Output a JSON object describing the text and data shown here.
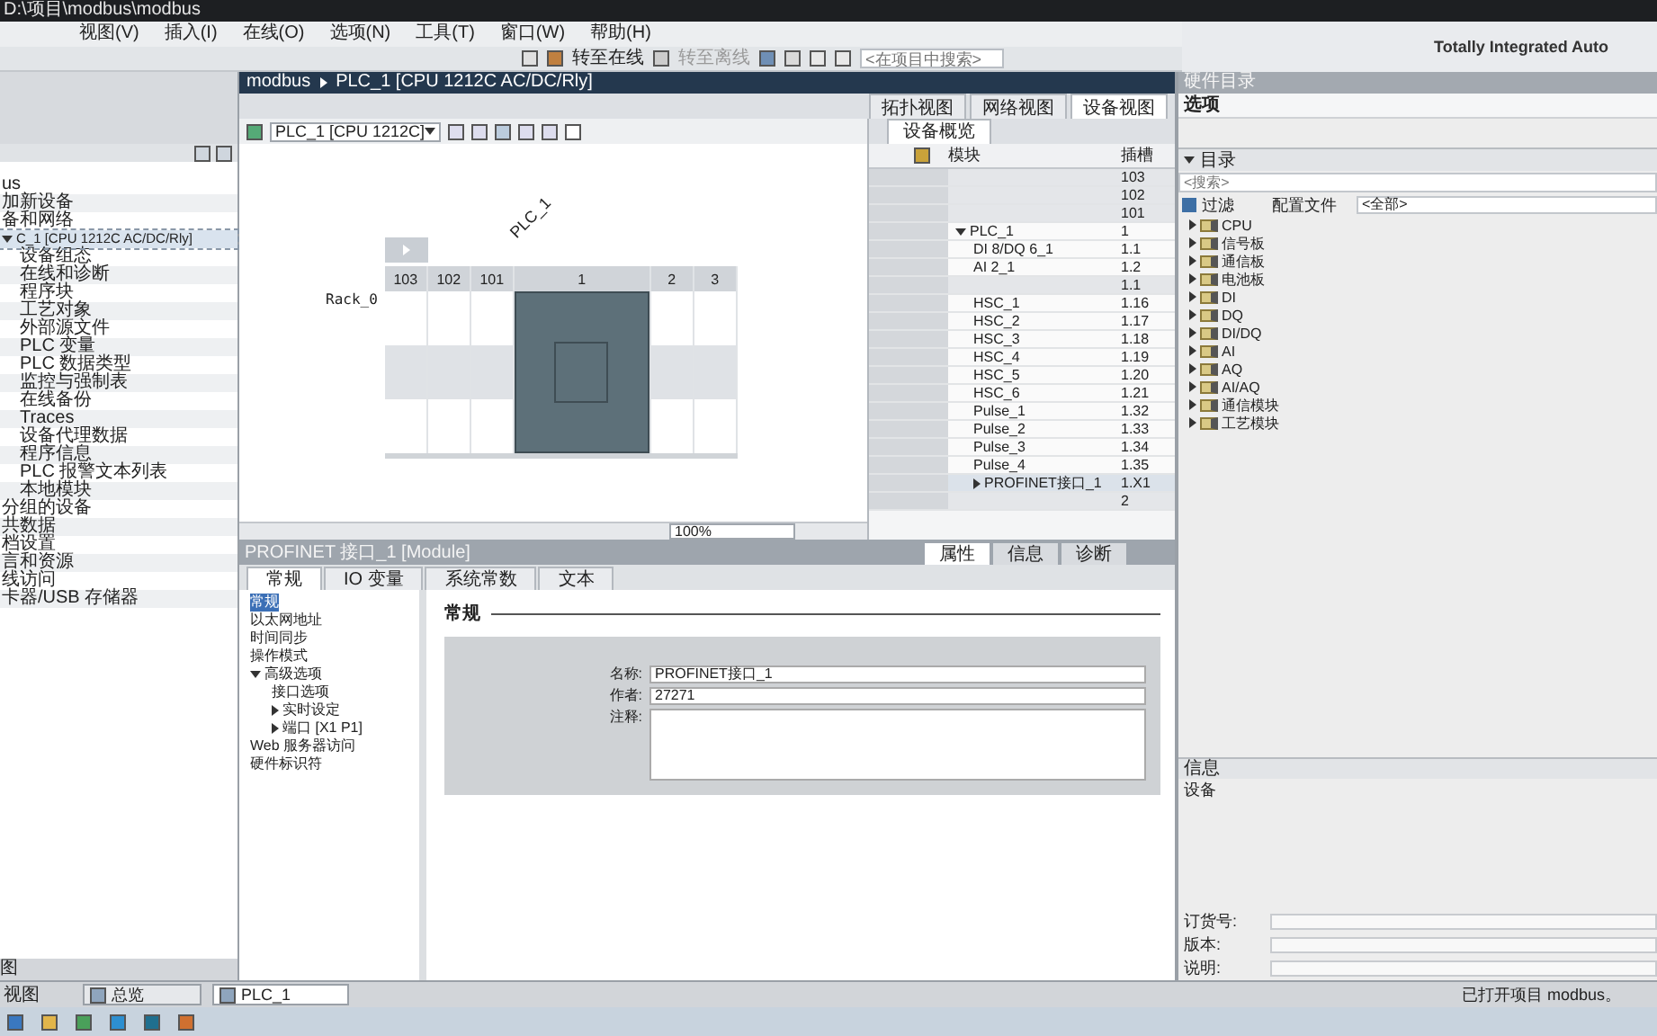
{
  "title_bar": {
    "title": "D:\\项目\\modbus\\modbus"
  },
  "brand": "Totally Integrated Auto",
  "menus": [
    "视图(V)",
    "插入(I)",
    "在线(O)",
    "选项(N)",
    "工具(T)",
    "窗口(W)",
    "帮助(H)"
  ],
  "toolbar": {
    "go_online": "转至在线",
    "go_offline": "转至离线",
    "search_placeholder": "<在项目中搜索>"
  },
  "project_tree": {
    "items": [
      {
        "label": "us"
      },
      {
        "label": "加新设备"
      },
      {
        "label": "备和网络"
      },
      {
        "label": "C_1 [CPU 1212C AC/DC/Rly]",
        "selected": true,
        "expanded": true,
        "children": [
          {
            "label": "设备组态"
          },
          {
            "label": "在线和诊断"
          },
          {
            "label": "程序块"
          },
          {
            "label": "工艺对象"
          },
          {
            "label": "外部源文件"
          },
          {
            "label": "PLC 变量"
          },
          {
            "label": "PLC 数据类型"
          },
          {
            "label": "监控与强制表"
          },
          {
            "label": "在线备份"
          },
          {
            "label": "Traces"
          },
          {
            "label": "设备代理数据"
          },
          {
            "label": "程序信息"
          },
          {
            "label": "PLC 报警文本列表"
          },
          {
            "label": "本地模块"
          }
        ]
      },
      {
        "label": "分组的设备"
      },
      {
        "label": "共数据"
      },
      {
        "label": "档设置"
      },
      {
        "label": "言和资源"
      },
      {
        "label": "线访问"
      },
      {
        "label": "卡器/USB 存储器"
      }
    ],
    "details_header": "图"
  },
  "editor": {
    "breadcrumb": [
      "modbus",
      "PLC_1 [CPU 1212C AC/DC/Rly]"
    ],
    "view_tabs": [
      {
        "label": "拓扑视图",
        "selected": false
      },
      {
        "label": "网络视图",
        "selected": false
      },
      {
        "label": "设备视图",
        "selected": true
      }
    ],
    "device_select": "PLC_1 [CPU 1212C]",
    "canvas": {
      "device_label": "PLC_1",
      "rack_label": "Rack_0",
      "slots": [
        "103",
        "102",
        "101",
        "1",
        "2",
        "3"
      ]
    },
    "zoom": "100%",
    "overview": {
      "tab": "设备概览",
      "columns": [
        "模块",
        "插槽"
      ],
      "rows": [
        {
          "slot": "103"
        },
        {
          "slot": "102"
        },
        {
          "slot": "101"
        },
        {
          "module": "PLC_1",
          "slot": "1",
          "expanded": true,
          "children": [
            {
              "module": "DI 8/DQ 6_1",
              "slot": "1.1"
            },
            {
              "module": "AI 2_1",
              "slot": "1.2"
            },
            {
              "slot": "1.1"
            },
            {
              "module": "HSC_1",
              "slot": "1.16"
            },
            {
              "module": "HSC_2",
              "slot": "1.17"
            },
            {
              "module": "HSC_3",
              "slot": "1.18"
            },
            {
              "module": "HSC_4",
              "slot": "1.19"
            },
            {
              "module": "HSC_5",
              "slot": "1.20"
            },
            {
              "module": "HSC_6",
              "slot": "1.21"
            },
            {
              "module": "Pulse_1",
              "slot": "1.32"
            },
            {
              "module": "Pulse_2",
              "slot": "1.33"
            },
            {
              "module": "Pulse_3",
              "slot": "1.34"
            },
            {
              "module": "Pulse_4",
              "slot": "1.35"
            },
            {
              "module": "PROFINET接口_1",
              "slot": "1.X1",
              "expanded": false,
              "selected": true
            }
          ]
        },
        {
          "slot": "2"
        }
      ]
    }
  },
  "inspector": {
    "title": "PROFINET 接口_1 [Module]",
    "tabs": [
      {
        "label": "属性",
        "selected": true
      },
      {
        "label": "信息",
        "selected": false
      },
      {
        "label": "诊断",
        "selected": false
      }
    ],
    "subtabs": [
      {
        "label": "常规",
        "selected": true
      },
      {
        "label": "IO 变量",
        "selected": false
      },
      {
        "label": "系统常数",
        "selected": false
      },
      {
        "label": "文本",
        "selected": false
      }
    ],
    "nav": [
      {
        "label": "常规",
        "selected": true
      },
      {
        "label": "以太网地址",
        "selected": false
      },
      {
        "label": "时间同步",
        "selected": false
      },
      {
        "label": "操作模式",
        "selected": false
      },
      {
        "label": "高级选项",
        "selected": false,
        "expanded": true,
        "children": [
          {
            "label": "接口选项",
            "selected": false
          },
          {
            "label": "实时设定",
            "selected": false,
            "expanded": false
          },
          {
            "label": "端口 [X1 P1]",
            "selected": false,
            "expanded": false
          }
        ]
      },
      {
        "label": "Web 服务器访问",
        "selected": false
      },
      {
        "label": "硬件标识符",
        "selected": false
      }
    ],
    "section": "常规",
    "fields": [
      {
        "label": "名称:",
        "value": "PROFINET接口_1",
        "kind": "line"
      },
      {
        "label": "作者:",
        "value": "27271",
        "kind": "line"
      },
      {
        "label": "注释:",
        "kind": "multiline"
      }
    ]
  },
  "catalog": {
    "title": "硬件目录",
    "options": "选项",
    "catalog_header": {
      "label": "目录",
      "expanded": true
    },
    "search_placeholder": "<搜索>",
    "filter": {
      "label": "过滤",
      "checked": true
    },
    "profile_label": "配置文件",
    "profile_value": "<全部>",
    "folders": [
      "CPU",
      "信号板",
      "通信板",
      "电池板",
      "DI",
      "DQ",
      "DI/DQ",
      "AI",
      "AQ",
      "AI/AQ",
      "通信模块",
      "工艺模块"
    ]
  },
  "info": {
    "title": "信息",
    "device": "设备",
    "fields": [
      "订货号:",
      "版本:",
      "说明:"
    ]
  },
  "status_bar": {
    "portal_view": "视图",
    "tabs": [
      {
        "label": "总览",
        "selected": false
      },
      {
        "label": "PLC_1",
        "selected": true
      }
    ],
    "status": "已打开项目 modbus。"
  }
}
